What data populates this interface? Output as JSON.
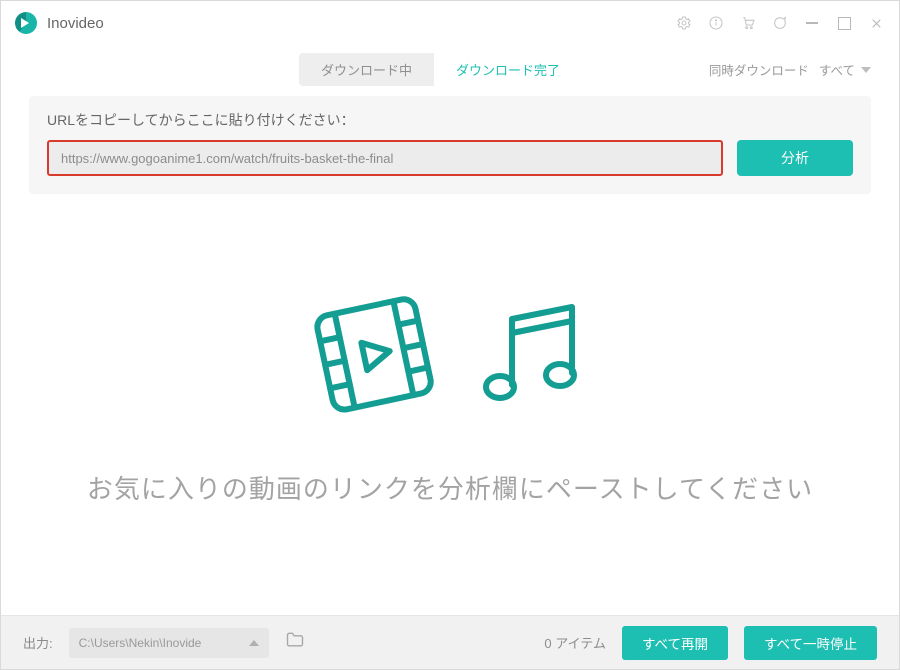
{
  "app": {
    "title": "Inovideo"
  },
  "tabs": {
    "downloading": "ダウンロード中",
    "completed": "ダウンロード完了"
  },
  "simultaneous": {
    "label": "同時ダウンロード",
    "value": "すべて"
  },
  "urlPanel": {
    "label": "URLをコピーしてからここに貼り付けください：",
    "value": "https://www.gogoanime1.com/watch/fruits-basket-the-final",
    "analyze": "分析"
  },
  "emptyState": {
    "message": "お気に入りの動画のリンクを分析欄にペーストしてください"
  },
  "footer": {
    "outputLabel": "出力:",
    "outputPath": "C:\\Users\\Nekin\\Inovide",
    "itemsCount": "0 アイテム",
    "resumeAll": "すべて再開",
    "pauseAll": "すべて一時停止"
  },
  "colors": {
    "accent": "#1dbfb2",
    "highlightBorder": "#d83a2b"
  }
}
